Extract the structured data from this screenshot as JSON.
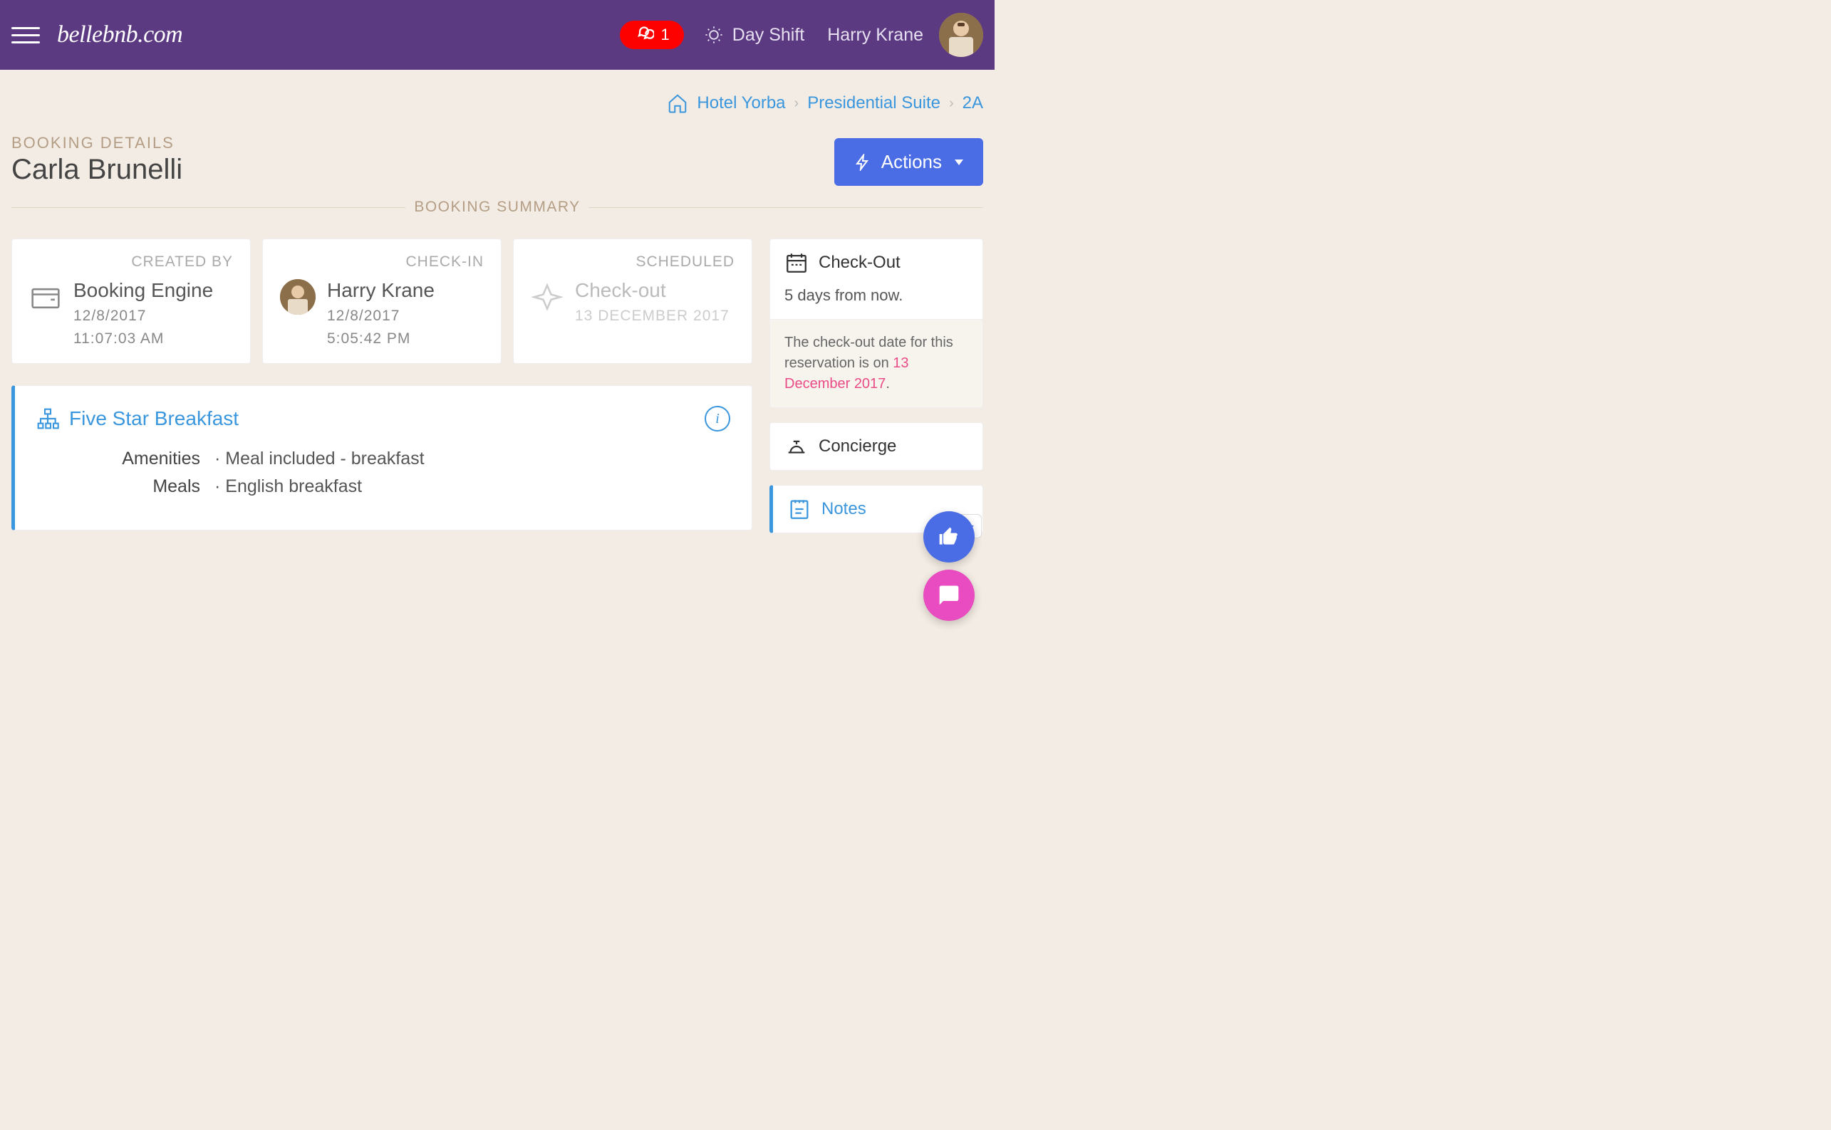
{
  "header": {
    "logo": "bellebnb.com",
    "notification_count": "1",
    "shift_label": "Day Shift",
    "username": "Harry Krane"
  },
  "breadcrumb": {
    "hotel": "Hotel Yorba",
    "suite": "Presidential Suite",
    "room": "2A"
  },
  "page": {
    "label": "BOOKING DETAILS",
    "guest_name": "Carla Brunelli",
    "actions_label": "Actions",
    "summary_divider": "BOOKING SUMMARY"
  },
  "cards": {
    "created_by": {
      "label": "CREATED BY",
      "title": "Booking Engine",
      "date": "12/8/2017",
      "time": "11:07:03 AM"
    },
    "check_in": {
      "label": "CHECK-IN",
      "title": "Harry Krane",
      "date": "12/8/2017",
      "time": "5:05:42 PM"
    },
    "scheduled": {
      "label": "SCHEDULED",
      "title": "Check-out",
      "date": "13 DECEMBER 2017"
    }
  },
  "package": {
    "name": "Five Star Breakfast",
    "amenities_label": "Amenities",
    "amenities_value": "· Meal included - breakfast",
    "meals_label": "Meals",
    "meals_value": "· English breakfast"
  },
  "side": {
    "checkout_title": "Check-Out",
    "checkout_sub": "5 days from now.",
    "checkout_note_pre": "The check-out date for this reservation is on ",
    "checkout_note_date": "13 December 2017",
    "checkout_note_post": ".",
    "concierge_title": "Concierge",
    "notes_title": "Notes"
  }
}
